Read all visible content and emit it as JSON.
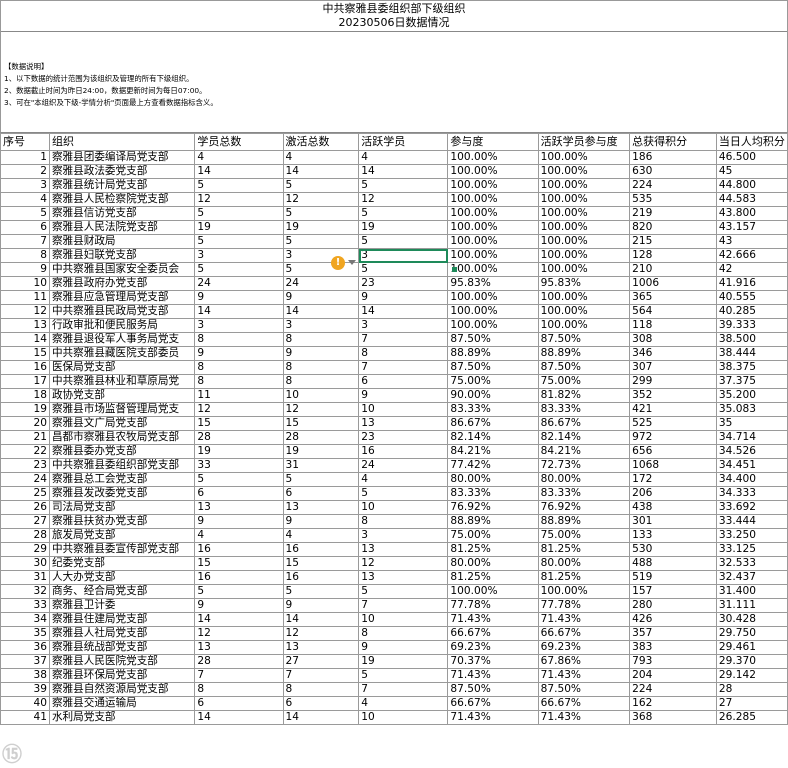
{
  "header": {
    "title": "中共察雅县委组织部下级组织",
    "subtitle": "20230506日数据情况"
  },
  "notes": {
    "heading": "【数据说明】",
    "lines": [
      "1、以下数据的统计范围为该组织及管理的所有下级组织。",
      "2、数据截止时间为昨日24:00，数据更新时间为每日07:00。",
      "3、可在\"本组织及下级-学情分析\"页面最上方查看数据指标含义。"
    ]
  },
  "columns": [
    "序号",
    "组织",
    "学员总数",
    "激活总数",
    "活跃学员",
    "参与度",
    "活跃学员参与度",
    "总获得积分",
    "当日人均积分"
  ],
  "rows": [
    [
      "1",
      "察雅县团委编译局党支部",
      "4",
      "4",
      "4",
      "100.00%",
      "100.00%",
      "186",
      "46.500"
    ],
    [
      "2",
      "察雅县政法委党支部",
      "14",
      "14",
      "14",
      "100.00%",
      "100.00%",
      "630",
      "45"
    ],
    [
      "3",
      "察雅县统计局党支部",
      "5",
      "5",
      "5",
      "100.00%",
      "100.00%",
      "224",
      "44.800"
    ],
    [
      "4",
      "察雅县人民检察院党支部",
      "12",
      "12",
      "12",
      "100.00%",
      "100.00%",
      "535",
      "44.583"
    ],
    [
      "5",
      "察雅县信访党支部",
      "5",
      "5",
      "5",
      "100.00%",
      "100.00%",
      "219",
      "43.800"
    ],
    [
      "6",
      "察雅县人民法院党支部",
      "19",
      "19",
      "19",
      "100.00%",
      "100.00%",
      "820",
      "43.157"
    ],
    [
      "7",
      "察雅县财政局",
      "5",
      "5",
      "5",
      "100.00%",
      "100.00%",
      "215",
      "43"
    ],
    [
      "8",
      "察雅县妇联党支部",
      "3",
      "3",
      "3",
      "100.00%",
      "100.00%",
      "128",
      "42.666"
    ],
    [
      "9",
      "中共察雅县国家安全委员会",
      "5",
      "5",
      "5",
      "100.00%",
      "100.00%",
      "210",
      "42"
    ],
    [
      "10",
      "察雅县政府办党支部",
      "24",
      "24",
      "23",
      "95.83%",
      "95.83%",
      "1006",
      "41.916"
    ],
    [
      "11",
      "察雅县应急管理局党支部",
      "9",
      "9",
      "9",
      "100.00%",
      "100.00%",
      "365",
      "40.555"
    ],
    [
      "12",
      "中共察雅县民政局党支部",
      "14",
      "14",
      "14",
      "100.00%",
      "100.00%",
      "564",
      "40.285"
    ],
    [
      "13",
      "行政审批和便民服务局",
      "3",
      "3",
      "3",
      "100.00%",
      "100.00%",
      "118",
      "39.333"
    ],
    [
      "14",
      "察雅县退役军人事务局党支",
      "8",
      "8",
      "7",
      "87.50%",
      "87.50%",
      "308",
      "38.500"
    ],
    [
      "15",
      "中共察雅县藏医院支部委员",
      "9",
      "9",
      "8",
      "88.89%",
      "88.89%",
      "346",
      "38.444"
    ],
    [
      "16",
      "医保局党支部",
      "8",
      "8",
      "7",
      "87.50%",
      "87.50%",
      "307",
      "38.375"
    ],
    [
      "17",
      "中共察雅县林业和草原局党",
      "8",
      "8",
      "6",
      "75.00%",
      "75.00%",
      "299",
      "37.375"
    ],
    [
      "18",
      "政协党支部",
      "11",
      "10",
      "9",
      "90.00%",
      "81.82%",
      "352",
      "35.200"
    ],
    [
      "19",
      "察雅县市场监督管理局党支",
      "12",
      "12",
      "10",
      "83.33%",
      "83.33%",
      "421",
      "35.083"
    ],
    [
      "20",
      "察雅县文广局党支部",
      "15",
      "15",
      "13",
      "86.67%",
      "86.67%",
      "525",
      "35"
    ],
    [
      "21",
      "昌都市察雅县农牧局党支部",
      "28",
      "28",
      "23",
      "82.14%",
      "82.14%",
      "972",
      "34.714"
    ],
    [
      "22",
      "察雅县委办党支部",
      "19",
      "19",
      "16",
      "84.21%",
      "84.21%",
      "656",
      "34.526"
    ],
    [
      "23",
      "中共察雅县委组织部党支部",
      "33",
      "31",
      "24",
      "77.42%",
      "72.73%",
      "1068",
      "34.451"
    ],
    [
      "24",
      "察雅县总工会党支部",
      "5",
      "5",
      "4",
      "80.00%",
      "80.00%",
      "172",
      "34.400"
    ],
    [
      "25",
      "察雅县发改委党支部",
      "6",
      "6",
      "5",
      "83.33%",
      "83.33%",
      "206",
      "34.333"
    ],
    [
      "26",
      "司法局党支部",
      "13",
      "13",
      "10",
      "76.92%",
      "76.92%",
      "438",
      "33.692"
    ],
    [
      "27",
      "察雅县扶贫办党支部",
      "9",
      "9",
      "8",
      "88.89%",
      "88.89%",
      "301",
      "33.444"
    ],
    [
      "28",
      "旅发局党支部",
      "4",
      "4",
      "3",
      "75.00%",
      "75.00%",
      "133",
      "33.250"
    ],
    [
      "29",
      "中共察雅县委宣传部党支部",
      "16",
      "16",
      "13",
      "81.25%",
      "81.25%",
      "530",
      "33.125"
    ],
    [
      "30",
      "纪委党支部",
      "15",
      "15",
      "12",
      "80.00%",
      "80.00%",
      "488",
      "32.533"
    ],
    [
      "31",
      "人大办党支部",
      "16",
      "16",
      "13",
      "81.25%",
      "81.25%",
      "519",
      "32.437"
    ],
    [
      "32",
      "商务、经合局党支部",
      "5",
      "5",
      "5",
      "100.00%",
      "100.00%",
      "157",
      "31.400"
    ],
    [
      "33",
      "察雅县卫计委",
      "9",
      "9",
      "7",
      "77.78%",
      "77.78%",
      "280",
      "31.111"
    ],
    [
      "34",
      "察雅县住建局党支部",
      "14",
      "14",
      "10",
      "71.43%",
      "71.43%",
      "426",
      "30.428"
    ],
    [
      "35",
      "察雅县人社局党支部",
      "12",
      "12",
      "8",
      "66.67%",
      "66.67%",
      "357",
      "29.750"
    ],
    [
      "36",
      "察雅县统战部党支部",
      "13",
      "13",
      "9",
      "69.23%",
      "69.23%",
      "383",
      "29.461"
    ],
    [
      "37",
      "察雅县人民医院党支部",
      "28",
      "27",
      "19",
      "70.37%",
      "67.86%",
      "793",
      "29.370"
    ],
    [
      "38",
      "察雅县环保局党支部",
      "7",
      "7",
      "5",
      "71.43%",
      "71.43%",
      "204",
      "29.142"
    ],
    [
      "39",
      "察雅县自然资源局党支部",
      "8",
      "8",
      "7",
      "87.50%",
      "87.50%",
      "224",
      "28"
    ],
    [
      "40",
      "察雅县交通运输局",
      "6",
      "6",
      "4",
      "66.67%",
      "66.67%",
      "162",
      "27"
    ],
    [
      "41",
      "水利局党支部",
      "14",
      "14",
      "10",
      "71.43%",
      "71.43%",
      "368",
      "26.285"
    ]
  ],
  "warning_icon": "warning-icon",
  "watermark": "⑮"
}
